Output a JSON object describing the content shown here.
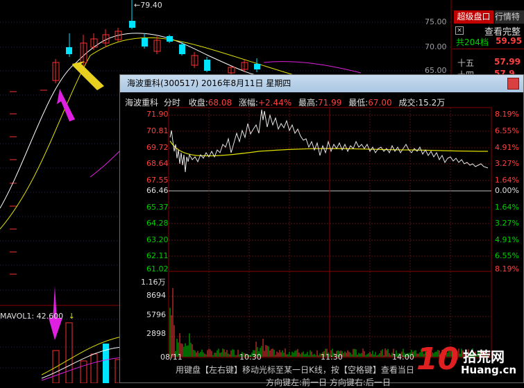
{
  "main_chart": {
    "high_marker": "79.40",
    "price_axis": [
      "75.00",
      "70.00",
      "65.00"
    ],
    "vol_indicator": "MAVOL1: 42.600"
  },
  "sidebar": {
    "tab_active": "超级盘口",
    "tab_other": "行情特",
    "checkbox_label": "查看完整",
    "total_label": "共204档",
    "total_value": "59.95",
    "rows": [
      {
        "label": "十五",
        "value": "57.99"
      },
      {
        "label": "十四",
        "value": "57.9"
      }
    ]
  },
  "popup": {
    "title": "海波重科(300517) 2016年8月11日 星期四",
    "stock_name": "海波重科",
    "view": "分时",
    "close_label": "收盘:",
    "close_value": "68.08",
    "change_label": "涨幅:",
    "change_value": "+2.44%",
    "high_label": "最高:",
    "high_value": "71.99",
    "low_label": "最低:",
    "low_value": "67.00",
    "volume_label": "成交:",
    "volume_value": "15.2万",
    "price_left": [
      "71.90",
      "70.81",
      "69.72",
      "68.64",
      "67.55",
      "66.46",
      "65.37",
      "64.28",
      "63.20",
      "62.11",
      "61.02"
    ],
    "pct_right": [
      "8.19%",
      "6.55%",
      "4.91%",
      "3.27%",
      "1.64%",
      "0.00%",
      "1.64%",
      "3.27%",
      "4.91%",
      "6.55%",
      "8.19%"
    ],
    "vol_axis": [
      "1.16万",
      "8694",
      "5796",
      "2898"
    ],
    "time_axis": [
      "08/11",
      "10:30",
      "11:30",
      "14:00"
    ],
    "hint1": "用键盘【左右键】移动光标至某一日K线，按【空格键】查看当日",
    "hint2": "方向键左:前一日   方向键右:后一日"
  },
  "colors": {
    "up": "#ff3c3c",
    "down": "#00e5ff",
    "green": "#00d000",
    "avg_line": "#e0e000",
    "price_line": "#e8e8e8",
    "magenta": "#e020e0"
  },
  "watermark": {
    "number": "10",
    "cn": "拾荒网",
    "en": "Huang.cn"
  }
}
